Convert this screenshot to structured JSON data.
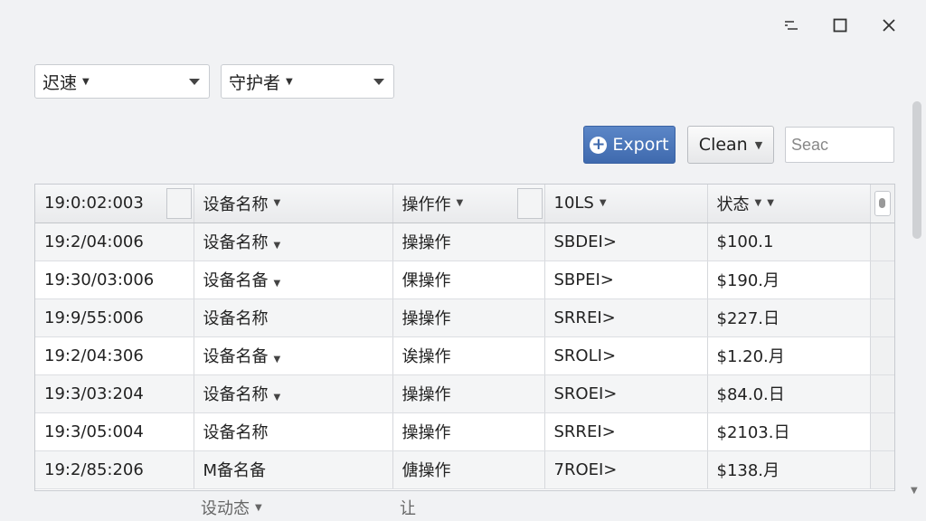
{
  "window_controls": {
    "minimize": "minimize",
    "maximize": "maximize",
    "close": "close"
  },
  "filters": [
    {
      "label": "迟速"
    },
    {
      "label": "守护者"
    }
  ],
  "toolbar": {
    "export_label": "Export",
    "clean_label": "Clean",
    "search_placeholder": "Seac"
  },
  "table": {
    "headers": [
      "19:0:02:003",
      "设备名称",
      "操作作",
      "10LS",
      "状态"
    ],
    "rows": [
      [
        "19:2/04:006",
        "设备名称",
        "操操作",
        "SBDEI>",
        "$100.1"
      ],
      [
        "19:30/03:006",
        "设备名备",
        "倮操作",
        "SBPEI>",
        "$190.月"
      ],
      [
        "19:9/55:006",
        "设备名称",
        "操操作",
        "SRREI>",
        "$227.日"
      ],
      [
        "19:2/04:306",
        "设备名备",
        "诶操作",
        "SROLI>",
        "$1.20.月"
      ],
      [
        "19:3/03:204",
        "设备名称",
        "操操作",
        "SROEI>",
        "$84.0.日"
      ],
      [
        "19:3/05:004",
        "设备名称",
        "操操作",
        "SRREI>",
        "$2103.日"
      ],
      [
        "19:2/85:206",
        "M备名备",
        "傏操作",
        "7ROEI>",
        "$138.月"
      ]
    ],
    "footer_partial": [
      "设动态",
      "让"
    ]
  },
  "colors": {
    "accent": "#3f6aae",
    "background": "#f1f2f4"
  }
}
